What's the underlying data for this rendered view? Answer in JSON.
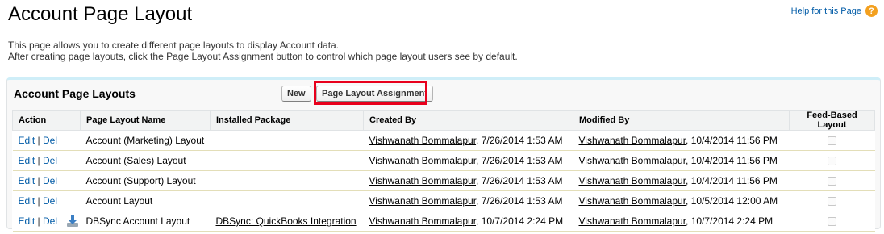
{
  "page": {
    "title": "Account Page Layout",
    "help_link": "Help for this Page",
    "help_icon": "question-mark-icon",
    "description_line1": "This page allows you to create different page layouts to display Account data.",
    "description_line2": "After creating page layouts, click the Page Layout Assignment button to control which page layout users see by default."
  },
  "panel": {
    "title": "Account Page Layouts",
    "new_button": "New",
    "assign_button": "Page Layout Assignment",
    "highlight_color": "#e8001c"
  },
  "table": {
    "headers": {
      "action": "Action",
      "name": "Page Layout Name",
      "package": "Installed Package",
      "created": "Created By",
      "modified": "Modified By",
      "feed": "Feed-Based Layout"
    },
    "edit_label": "Edit",
    "separator": "|",
    "del_label": "Del",
    "rows": [
      {
        "name": "Account (Marketing) Layout",
        "package": "",
        "created_by": "Vishwanath Bommalapur",
        "created_date": ", 7/26/2014 1:53 AM",
        "modified_by": "Vishwanath Bommalapur",
        "modified_date": ", 10/4/2014 11:56 PM",
        "feed_based": false
      },
      {
        "name": "Account (Sales) Layout",
        "package": "",
        "created_by": "Vishwanath Bommalapur",
        "created_date": ", 7/26/2014 1:53 AM",
        "modified_by": "Vishwanath Bommalapur",
        "modified_date": ", 10/4/2014 11:56 PM",
        "feed_based": false
      },
      {
        "name": "Account (Support) Layout",
        "package": "",
        "created_by": "Vishwanath Bommalapur",
        "created_date": ", 7/26/2014 1:53 AM",
        "modified_by": "Vishwanath Bommalapur",
        "modified_date": ", 10/4/2014 11:56 PM",
        "feed_based": false
      },
      {
        "name": "Account Layout",
        "package": "",
        "created_by": "Vishwanath Bommalapur",
        "created_date": ", 7/26/2014 1:53 AM",
        "modified_by": "Vishwanath Bommalapur",
        "modified_date": ", 10/5/2014 12:00 AM",
        "feed_based": false
      },
      {
        "name": "DBSync Account Layout",
        "package": "DBSync: QuickBooks Integration",
        "package_icon": "download-package-icon",
        "created_by": "Vishwanath Bommalapur",
        "created_date": ", 10/7/2014 2:24 PM",
        "modified_by": "Vishwanath Bommalapur",
        "modified_date": ", 10/7/2014 2:24 PM",
        "feed_based": false
      }
    ]
  }
}
